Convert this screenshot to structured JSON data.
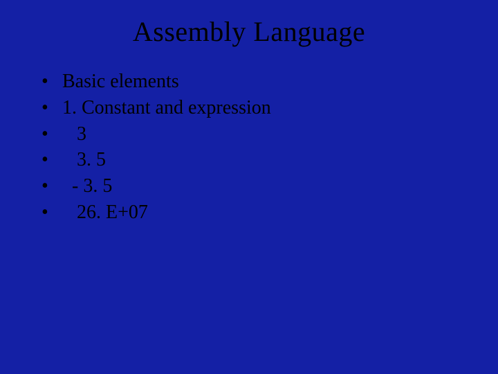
{
  "slide": {
    "title": "Assembly Language",
    "bullets": [
      {
        "marker": "•",
        "text": "Basic elements"
      },
      {
        "marker": "•",
        "text": "1. Constant and expression"
      },
      {
        "marker": "•",
        "text": "   3"
      },
      {
        "marker": "•",
        "text": "   3. 5"
      },
      {
        "marker": "•",
        "text": "  - 3. 5"
      },
      {
        "marker": "•",
        "text": "   26. E+07"
      }
    ]
  }
}
